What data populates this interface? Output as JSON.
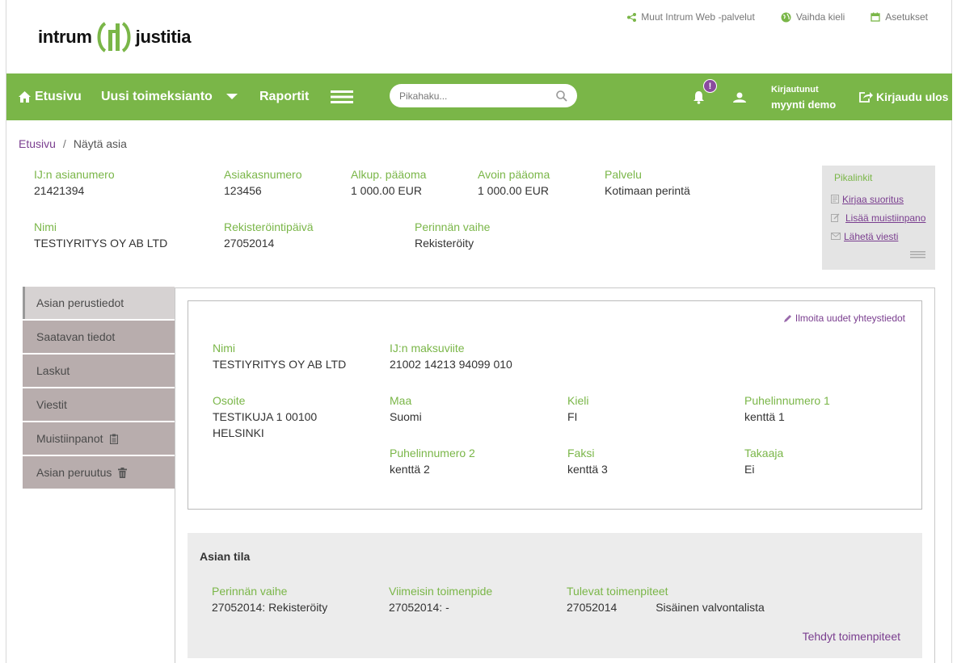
{
  "logo": {
    "left": "intrum",
    "right": "justitia"
  },
  "toplinks": [
    {
      "label": "Muut Intrum Web -palvelut",
      "icon": "share-icon"
    },
    {
      "label": "Vaihda kieli",
      "icon": "globe-icon"
    },
    {
      "label": "Asetukset",
      "icon": "calendar-icon"
    }
  ],
  "nav": {
    "home": "Etusivu",
    "new_assignment": "Uusi toimeksianto",
    "reports": "Raportit",
    "search_placeholder": "Pikahaku...",
    "notification_count": "!",
    "logged_in_label": "Kirjautunut",
    "user_name": "myynti demo",
    "logout": "Kirjaudu ulos"
  },
  "breadcrumb": {
    "home": "Etusivu",
    "separator": "/",
    "current": "Näytä asia"
  },
  "summary": {
    "case_no_label": "IJ:n asianumero",
    "case_no": "21421394",
    "customer_no_label": "Asiakasnumero",
    "customer_no": "123456",
    "orig_principal_label": "Alkup. pääoma",
    "orig_principal": "1 000.00 EUR",
    "open_principal_label": "Avoin pääoma",
    "open_principal": "1 000.00 EUR",
    "service_label": "Palvelu",
    "service": "Kotimaan perintä",
    "name_label": "Nimi",
    "name": "TESTIYRITYS OY AB LTD",
    "reg_date_label": "Rekisteröintipäivä",
    "reg_date": "27052014",
    "phase_label": "Perinnän vaihe",
    "phase": "Rekisteröity"
  },
  "quicklinks": {
    "title": "Pikalinkit",
    "items": [
      "Kirjaa suoritus",
      "Lisää muistiinpano",
      "Lähetä viesti"
    ]
  },
  "sidetabs": [
    "Asian perustiedot",
    "Saatavan tiedot",
    "Laskut",
    "Viestit",
    "Muistiinpanot",
    "Asian peruutus"
  ],
  "details": {
    "edit_link": "Ilmoita uudet yhteystiedot",
    "name_label": "Nimi",
    "name": "TESTIYRITYS OY AB LTD",
    "ref_label": "IJ:n maksuviite",
    "ref": "21002 14213 94099 010",
    "address_label": "Osoite",
    "address_line1": "TESTIKUJA 1 00100",
    "address_line2": "HELSINKI",
    "country_label": "Maa",
    "country": "Suomi",
    "language_label": "Kieli",
    "language": "FI",
    "phone1_label": "Puhelinnumero 1",
    "phone1": "kenttä 1",
    "phone2_label": "Puhelinnumero 2",
    "phone2": "kenttä 2",
    "fax_label": "Faksi",
    "fax": "kenttä 3",
    "guarantor_label": "Takaaja",
    "guarantor": "Ei"
  },
  "status": {
    "heading": "Asian tila",
    "phase_label": "Perinnän vaihe",
    "phase": "27052014: Rekisteröity",
    "last_action_label": "Viimeisin toimenpide",
    "last_action": "27052014: -",
    "upcoming_label": "Tulevat toimenpiteet",
    "upcoming_date": "27052014",
    "upcoming_action": "Sisäinen valvontalista",
    "done_link": "Tehdyt toimenpiteet"
  },
  "colors": {
    "brand_green": "#7ab648",
    "link_purple": "#7a3e8f",
    "tab_bg": "#b8adad"
  }
}
